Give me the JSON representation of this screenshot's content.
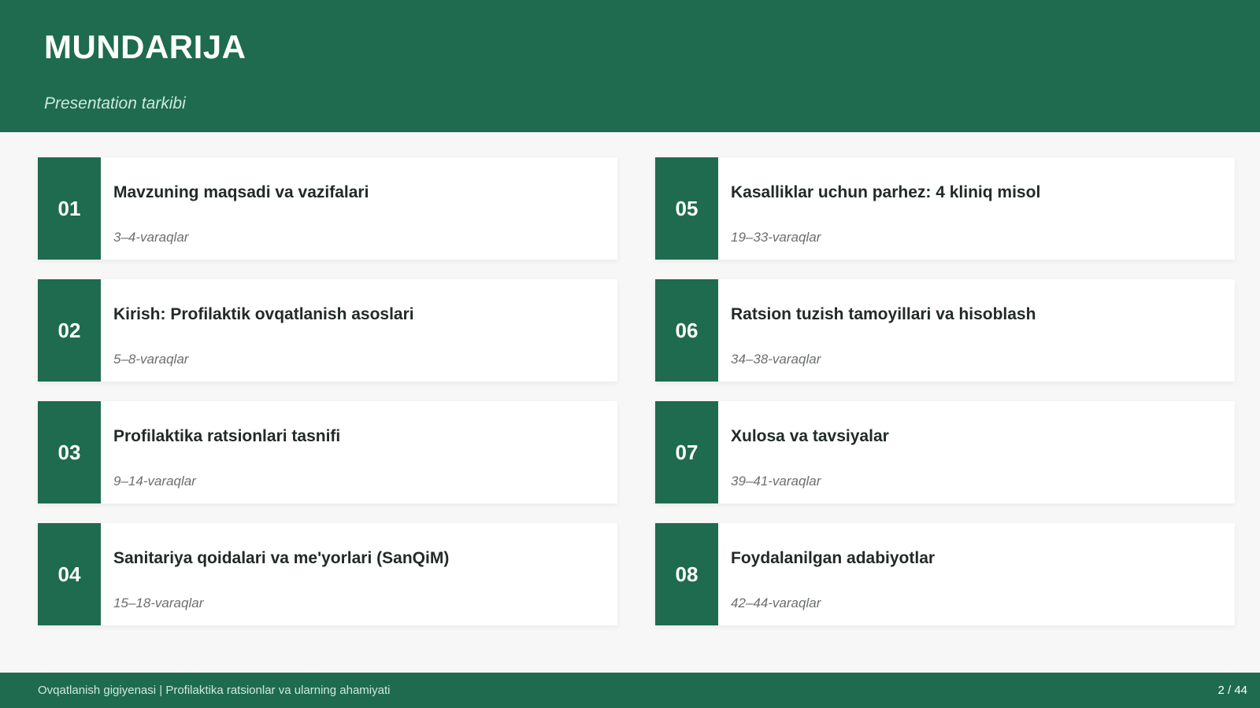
{
  "header": {
    "title": "MUNDARIJA",
    "subtitle": "Presentation tarkibi"
  },
  "sections": [
    {
      "num": "01",
      "title": "Mavzuning maqsadi va vazifalari",
      "pages": "3–4-varaqlar"
    },
    {
      "num": "05",
      "title": "Kasalliklar uchun parhez: 4 kliniq misol",
      "pages": "19–33-varaqlar"
    },
    {
      "num": "02",
      "title": "Kirish: Profilaktik ovqatlanish asoslari",
      "pages": "5–8-varaqlar"
    },
    {
      "num": "06",
      "title": "Ratsion tuzish tamoyillari va hisoblash",
      "pages": "34–38-varaqlar"
    },
    {
      "num": "03",
      "title": "Profilaktika ratsionlari tasnifi",
      "pages": "9–14-varaqlar"
    },
    {
      "num": "07",
      "title": "Xulosa va tavsiyalar",
      "pages": "39–41-varaqlar"
    },
    {
      "num": "04",
      "title": "Sanitariya qoidalari va me'yorlari (SanQiM)",
      "pages": "15–18-varaqlar"
    },
    {
      "num": "08",
      "title": "Foydalanilgan adabiyotlar",
      "pages": "42–44-varaqlar"
    }
  ],
  "footer": {
    "text": "Ovqatlanish gigiyenasi | Profilaktika ratsionlar va ularning ahamiyati",
    "page": "2 / 44"
  },
  "colors": {
    "accent": "#1e6b4f",
    "background": "#f6f7f6"
  }
}
